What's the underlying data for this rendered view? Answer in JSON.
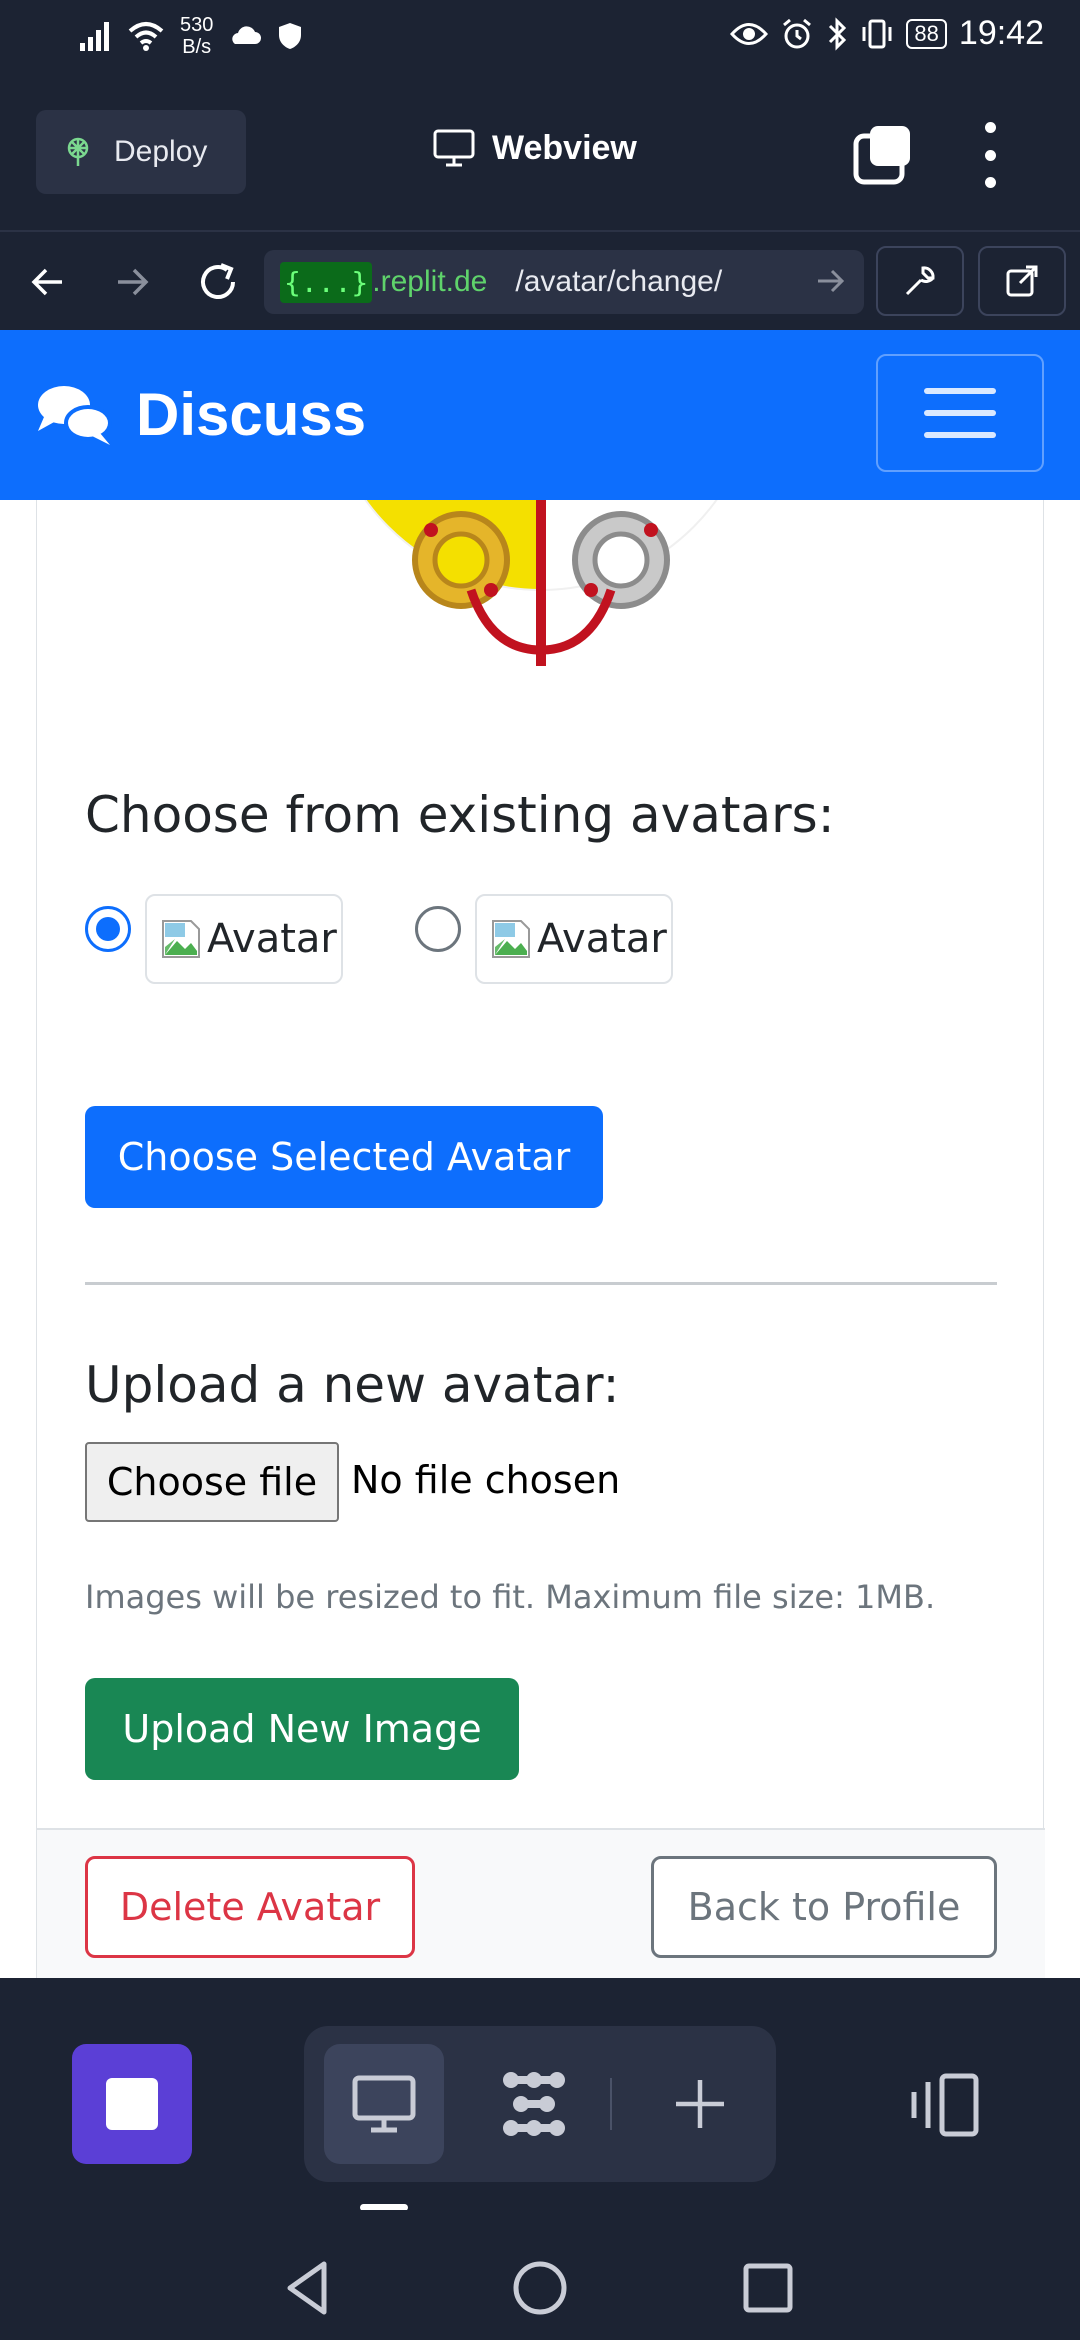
{
  "status_bar": {
    "net_speed_value": "530",
    "net_speed_unit": "B/s",
    "battery": "88",
    "time": "19:42",
    "icons": [
      "signal-icon",
      "wifi-icon",
      "cloud-icon",
      "shield-icon",
      "eye-icon",
      "alarm-icon",
      "bluetooth-icon",
      "vibrate-icon"
    ]
  },
  "replit": {
    "deploy_label": "Deploy",
    "webview_title": "Webview"
  },
  "browser": {
    "url_badge": "{...}",
    "url_host": ".replit.de",
    "url_path": "/avatar/change/"
  },
  "site": {
    "brand": "Discuss",
    "brand_color": "#0d6efd"
  },
  "form": {
    "choose_heading": "Choose from existing avatars:",
    "avatar_options": [
      {
        "alt": "Avatar",
        "selected": true
      },
      {
        "alt": "Avatar",
        "selected": false
      }
    ],
    "choose_button": "Choose Selected Avatar",
    "upload_heading": "Upload a new avatar:",
    "file_button": "Choose file",
    "file_status": "No file chosen",
    "help_text": "Images will be resized to fit. Maximum file size: 1MB.",
    "upload_button": "Upload New Image"
  },
  "footer": {
    "delete_button": "Delete Avatar",
    "back_button": "Back to Profile"
  },
  "colors": {
    "primary": "#0d6efd",
    "success": "#198754",
    "danger": "#dc3545",
    "secondary": "#6c757d",
    "ide_bg": "#1c2333",
    "stop_button": "#5b3fd6"
  }
}
